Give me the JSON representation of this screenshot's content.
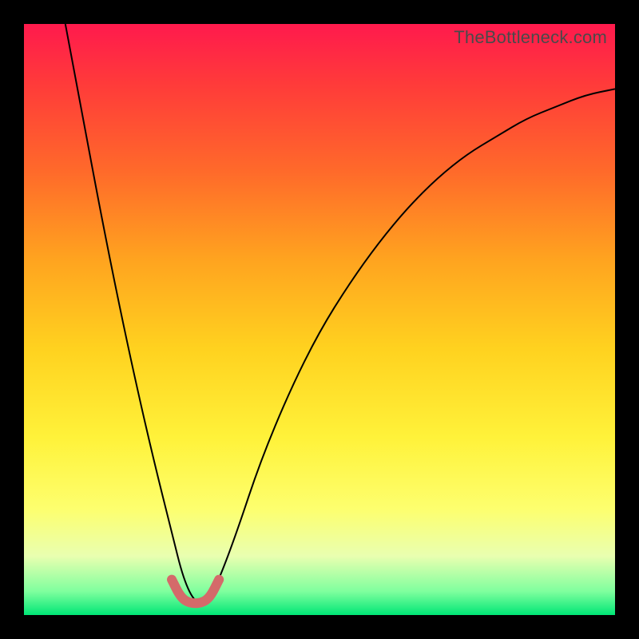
{
  "watermark": "TheBottleneck.com",
  "chart_data": {
    "type": "line",
    "title": "",
    "xlabel": "",
    "ylabel": "",
    "xlim": [
      0,
      100
    ],
    "ylim": [
      0,
      100
    ],
    "background_gradient": {
      "top_color": "#ff1a4d",
      "bottom_color": "#00e676",
      "stops": [
        "#ff1a4d",
        "#ff6a2a",
        "#ffd21f",
        "#fdff6e",
        "#00e676"
      ]
    },
    "series": [
      {
        "name": "bottleneck-curve",
        "color": "#000000",
        "stroke_width": 2,
        "x": [
          7,
          10,
          13,
          16,
          19,
          22,
          25,
          27,
          29,
          31,
          33,
          36,
          40,
          45,
          50,
          55,
          60,
          65,
          70,
          75,
          80,
          85,
          90,
          95,
          100
        ],
        "values": [
          100,
          84,
          68,
          53,
          39,
          26,
          14,
          6,
          2,
          2,
          6,
          14,
          26,
          38,
          48,
          56,
          63,
          69,
          74,
          78,
          81,
          84,
          86,
          88,
          89
        ]
      },
      {
        "name": "optimal-zone-marker",
        "color": "#d46a6a",
        "stroke_width": 10,
        "x": [
          25,
          26.5,
          28,
          30,
          31.5,
          33
        ],
        "values": [
          6,
          3,
          2,
          2,
          3,
          6
        ]
      }
    ],
    "grid": false,
    "legend": false
  }
}
